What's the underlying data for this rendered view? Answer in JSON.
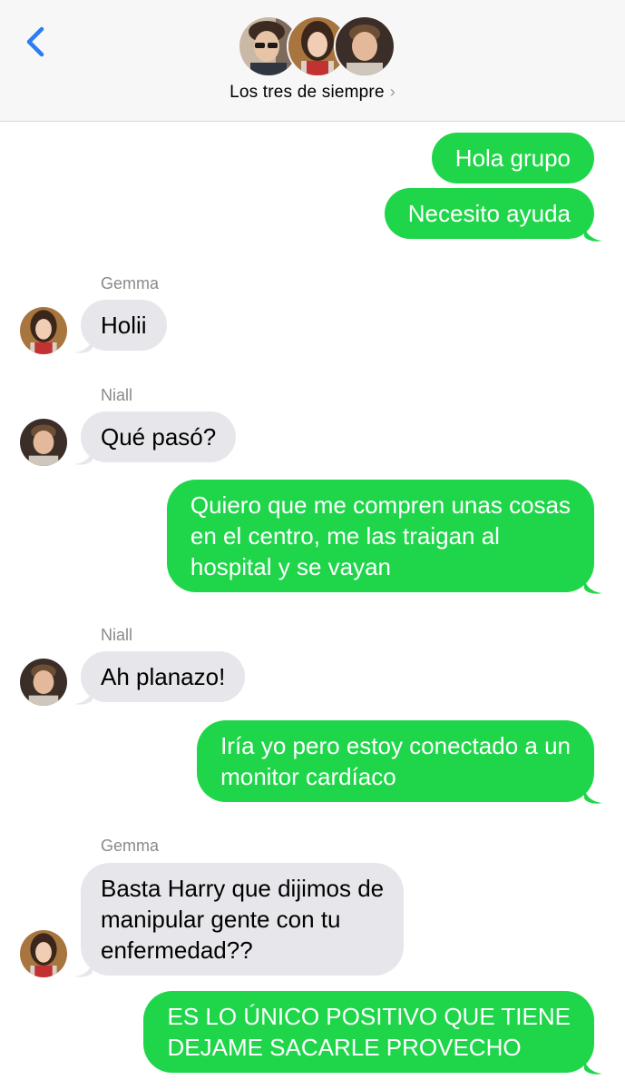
{
  "header": {
    "back_icon": "chevron-left-icon",
    "group_name": "Los tres de siempre",
    "chevron": "›",
    "accent": "#2b7cf6"
  },
  "colors": {
    "outgoing": "#1fd64a",
    "incoming": "#e7e6eb"
  },
  "messages": [
    {
      "from": "me",
      "text": "Hola grupo"
    },
    {
      "from": "me",
      "text": "Necesito ayuda"
    },
    {
      "from": "Gemma",
      "sender_label": "Gemma",
      "text": "Holii"
    },
    {
      "from": "Niall",
      "sender_label": "Niall",
      "text": "Qué pasó?"
    },
    {
      "from": "me",
      "lines": [
        "Quiero que me compren unas cosas",
        "en el centro, me las traigan al",
        "hospital y se vayan"
      ]
    },
    {
      "from": "Niall",
      "sender_label": "Niall",
      "text": "Ah planazo!"
    },
    {
      "from": "me",
      "lines": [
        "Iría yo pero estoy conectado a un",
        "monitor cardíaco"
      ]
    },
    {
      "from": "Gemma",
      "sender_label": "Gemma",
      "lines": [
        "Basta Harry que dijimos de",
        "manipular gente con tu",
        "enfermedad??"
      ]
    },
    {
      "from": "me",
      "lines": [
        "ES LO ÚNICO POSITIVO QUE TIENE",
        "DEJAME SACARLE PROVECHO"
      ]
    }
  ]
}
